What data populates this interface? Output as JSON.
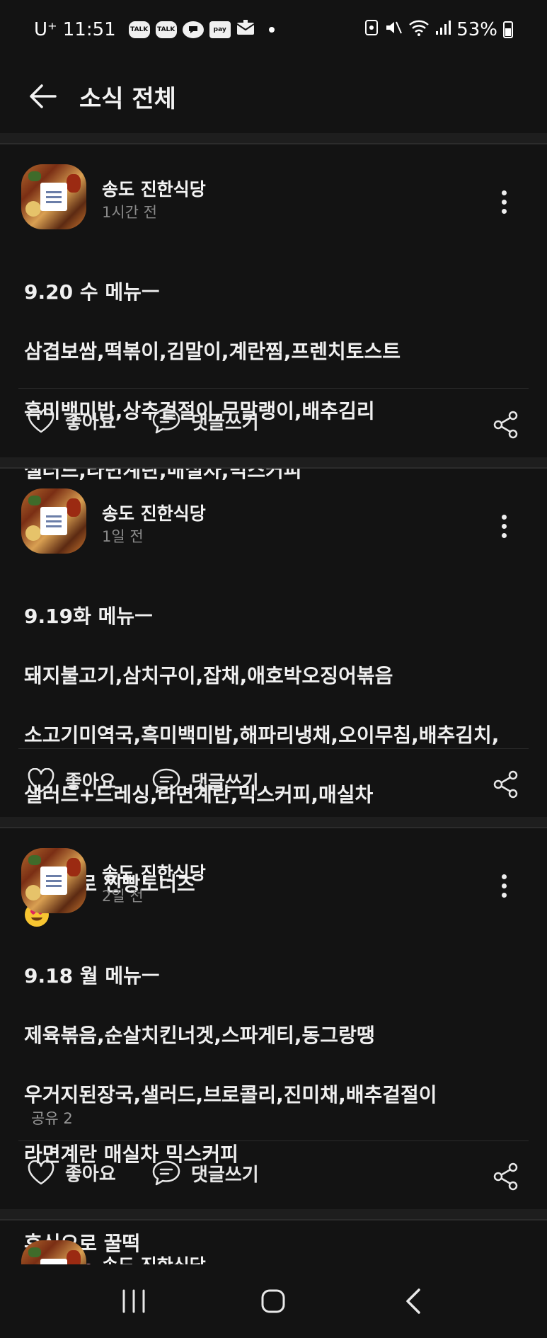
{
  "status": {
    "carrier": "U⁺",
    "time": "11:51",
    "notif_icons": [
      "TALK",
      "TALK",
      "pay"
    ],
    "battery": "53%"
  },
  "appbar": {
    "title": "소식 전체"
  },
  "posts": [
    {
      "author": "송도 진한식당",
      "time": "1시간 전",
      "title": "9.20 수 메뉴ㅡ",
      "lines": [
        "삼겹보쌈,떡볶이,김말이,계란찜,프렌치토스트",
        "흑미백미밥,상추겉절이,무말랭이,배추김리",
        "샐러드,라면계란,매실차,믹스커피"
      ],
      "share_count": "",
      "like_label": "좋아요",
      "comment_label": "댓글쓰기"
    },
    {
      "author": "송도 진한식당",
      "time": "1일 전",
      "title": "9.19화 메뉴ㅡ",
      "lines": [
        "돼지불고기,삼치구이,잡채,애호박오징어볶음",
        "소고기미역국,흑미백미밥,해파리냉채,오이무침,배추김치,",
        "샐러드+드레싱,라면계란,믹스커피,매실차",
        "후식으로 찐빵도너츠"
      ],
      "share_count": "",
      "like_label": "좋아요",
      "comment_label": "댓글쓰기"
    },
    {
      "author": "송도 진한식당",
      "time": "2일 전",
      "title": "9.18 월 메뉴ㅡ",
      "lines": [
        "제육볶음,순살치킨너겟,스파게티,동그랑땡",
        "우거지된장국,샐러드,브로콜리,진미채,배추겉절이",
        "라면계란 매실차 믹스커피",
        "후식으로 꿀떡"
      ],
      "share_count": "공유 2",
      "like_label": "좋아요",
      "comment_label": "댓글쓰기"
    },
    {
      "author": "송도 진한식당"
    }
  ],
  "colors": {
    "background": "#131313",
    "separator": "#1e1e1e",
    "text": "#f2f2f2",
    "muted": "#8a8a8a"
  }
}
